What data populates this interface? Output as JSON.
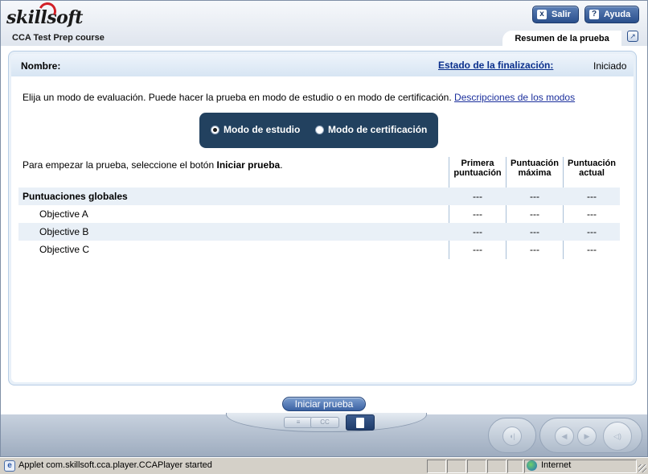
{
  "header": {
    "logo_text": "skillsoft",
    "course_title": "CCA Test Prep course",
    "exit_button": "Salir",
    "help_button": "Ayuda",
    "exit_icon": "x",
    "help_icon": "?",
    "active_tab": "Resumen de la prueba"
  },
  "panel": {
    "name_label": "Nombre:",
    "completion_link": "Estado de la finalización:",
    "completion_value": "Iniciado",
    "instructions_text": "Elija un modo de evaluación. Puede hacer la prueba en modo de estudio o en modo de certificación.",
    "modes_link": "Descripciones de los modos",
    "modes": {
      "study": {
        "label": "Modo de estudio",
        "selected": true
      },
      "certification": {
        "label": "Modo de certificación",
        "selected": false
      }
    },
    "start_hint_prefix": "Para empezar la prueba, seleccione el botón",
    "start_hint_bold": "Iniciar prueba",
    "start_hint_suffix": ".",
    "columns": {
      "first": [
        "Primera",
        "puntuación"
      ],
      "max": [
        "Puntuación",
        "máxima"
      ],
      "current": [
        "Puntuación",
        "actual"
      ]
    },
    "rows": [
      {
        "label": "Puntuaciones globales",
        "bold": true,
        "first": "---",
        "max": "---",
        "current": "---"
      },
      {
        "label": "Objective A",
        "bold": false,
        "first": "---",
        "max": "---",
        "current": "---"
      },
      {
        "label": "Objective B",
        "bold": false,
        "first": "---",
        "max": "---",
        "current": "---"
      },
      {
        "label": "Objective C",
        "bold": false,
        "first": "---",
        "max": "---",
        "current": "---"
      }
    ]
  },
  "start_button": "Iniciar prueba",
  "player": {
    "icons": [
      "transcript-icon",
      "captions-icon",
      "document-icon",
      "audio-icon",
      "previous-icon",
      "next-icon",
      "volume-icon"
    ],
    "captions_label": "CC"
  },
  "browser_status": {
    "message": "Applet com.skillsoft.cca.player.CCAPlayer started",
    "zone": "Internet"
  },
  "colors": {
    "accent": "#2a4f8c",
    "mode_box": "#22415f",
    "row_shade": "#e9f0f7",
    "link": "#0a2f8c"
  }
}
